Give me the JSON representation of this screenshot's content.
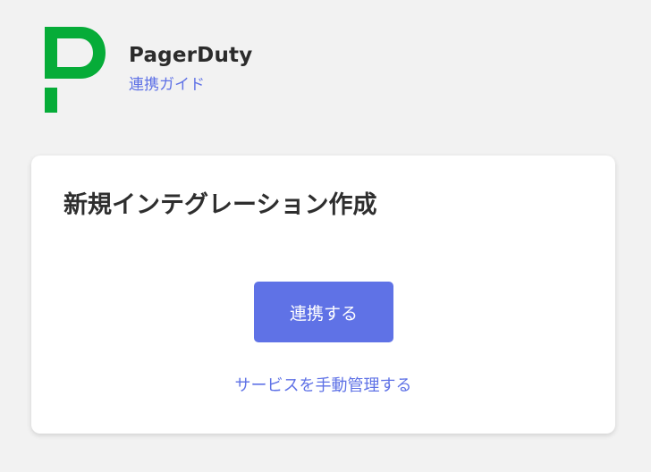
{
  "brand": {
    "name": "PagerDuty",
    "subtitle": "連携ガイド",
    "logo_color": "#06ac38"
  },
  "card": {
    "title": "新規インテグレーション作成",
    "primary_button_label": "連携する",
    "secondary_link_label": "サービスを手動管理する"
  },
  "colors": {
    "accent": "#5f72e6",
    "background": "#f2f2f2",
    "card_background": "#ffffff"
  }
}
